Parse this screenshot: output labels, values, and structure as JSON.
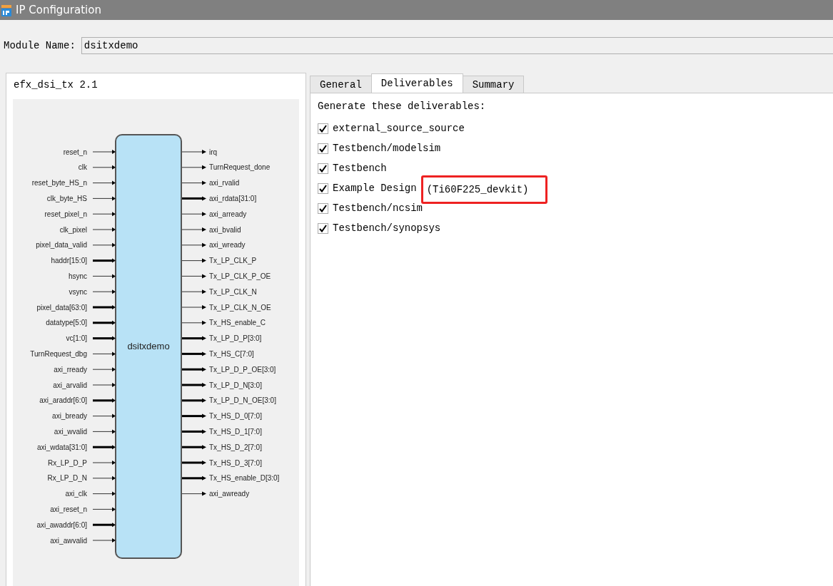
{
  "window": {
    "title": "IP Configuration"
  },
  "module_name": {
    "label": "Module Name:",
    "value": "dsitxdemo"
  },
  "diagram": {
    "title": "efx_dsi_tx 2.1",
    "block_name": "dsitxdemo",
    "inputs": [
      {
        "name": "reset_n",
        "bus": false
      },
      {
        "name": "clk",
        "bus": false
      },
      {
        "name": "reset_byte_HS_n",
        "bus": false
      },
      {
        "name": "clk_byte_HS",
        "bus": false
      },
      {
        "name": "reset_pixel_n",
        "bus": false
      },
      {
        "name": "clk_pixel",
        "bus": false
      },
      {
        "name": "pixel_data_valid",
        "bus": false
      },
      {
        "name": "haddr[15:0]",
        "bus": true
      },
      {
        "name": "hsync",
        "bus": false
      },
      {
        "name": "vsync",
        "bus": false
      },
      {
        "name": "pixel_data[63:0]",
        "bus": true
      },
      {
        "name": "datatype[5:0]",
        "bus": true
      },
      {
        "name": "vc[1:0]",
        "bus": true
      },
      {
        "name": "TurnRequest_dbg",
        "bus": false
      },
      {
        "name": "axi_rready",
        "bus": false
      },
      {
        "name": "axi_arvalid",
        "bus": false
      },
      {
        "name": "axi_araddr[6:0]",
        "bus": true
      },
      {
        "name": "axi_bready",
        "bus": false
      },
      {
        "name": "axi_wvalid",
        "bus": false
      },
      {
        "name": "axi_wdata[31:0]",
        "bus": true
      },
      {
        "name": "Rx_LP_D_P",
        "bus": false
      },
      {
        "name": "Rx_LP_D_N",
        "bus": false
      },
      {
        "name": "axi_clk",
        "bus": false
      },
      {
        "name": "axi_reset_n",
        "bus": false
      },
      {
        "name": "axi_awaddr[6:0]",
        "bus": true
      },
      {
        "name": "axi_awvalid",
        "bus": false
      }
    ],
    "outputs": [
      {
        "name": "irq",
        "bus": false
      },
      {
        "name": "TurnRequest_done",
        "bus": false
      },
      {
        "name": "axi_rvalid",
        "bus": false
      },
      {
        "name": "axi_rdata[31:0]",
        "bus": true
      },
      {
        "name": "axi_arready",
        "bus": false
      },
      {
        "name": "axi_bvalid",
        "bus": false
      },
      {
        "name": "axi_wready",
        "bus": false
      },
      {
        "name": "Tx_LP_CLK_P",
        "bus": false
      },
      {
        "name": "Tx_LP_CLK_P_OE",
        "bus": false
      },
      {
        "name": "Tx_LP_CLK_N",
        "bus": false
      },
      {
        "name": "Tx_LP_CLK_N_OE",
        "bus": false
      },
      {
        "name": "Tx_HS_enable_C",
        "bus": false
      },
      {
        "name": "Tx_LP_D_P[3:0]",
        "bus": true
      },
      {
        "name": "Tx_HS_C[7:0]",
        "bus": true
      },
      {
        "name": "Tx_LP_D_P_OE[3:0]",
        "bus": true
      },
      {
        "name": "Tx_LP_D_N[3:0]",
        "bus": true
      },
      {
        "name": "Tx_LP_D_N_OE[3:0]",
        "bus": true
      },
      {
        "name": "Tx_HS_D_0[7:0]",
        "bus": true
      },
      {
        "name": "Tx_HS_D_1[7:0]",
        "bus": true
      },
      {
        "name": "Tx_HS_D_2[7:0]",
        "bus": true
      },
      {
        "name": "Tx_HS_D_3[7:0]",
        "bus": true
      },
      {
        "name": "Tx_HS_enable_D[3:0]",
        "bus": true
      },
      {
        "name": "axi_awready",
        "bus": false
      }
    ]
  },
  "tabs": [
    {
      "label": "General",
      "selected": false
    },
    {
      "label": "Deliverables",
      "selected": true
    },
    {
      "label": "Summary",
      "selected": false
    }
  ],
  "deliverables": {
    "heading": "Generate these deliverables:",
    "items": [
      {
        "label": "external_source_source",
        "checked": true
      },
      {
        "label": "Testbench/modelsim",
        "checked": true
      },
      {
        "label": "Testbench",
        "checked": true
      },
      {
        "label": "Example Design",
        "detail": "(Ti60F225_devkit)",
        "highlighted": true,
        "checked": true
      },
      {
        "label": "Testbench/ncsim",
        "checked": true
      },
      {
        "label": "Testbench/synopsys",
        "checked": true
      }
    ]
  }
}
